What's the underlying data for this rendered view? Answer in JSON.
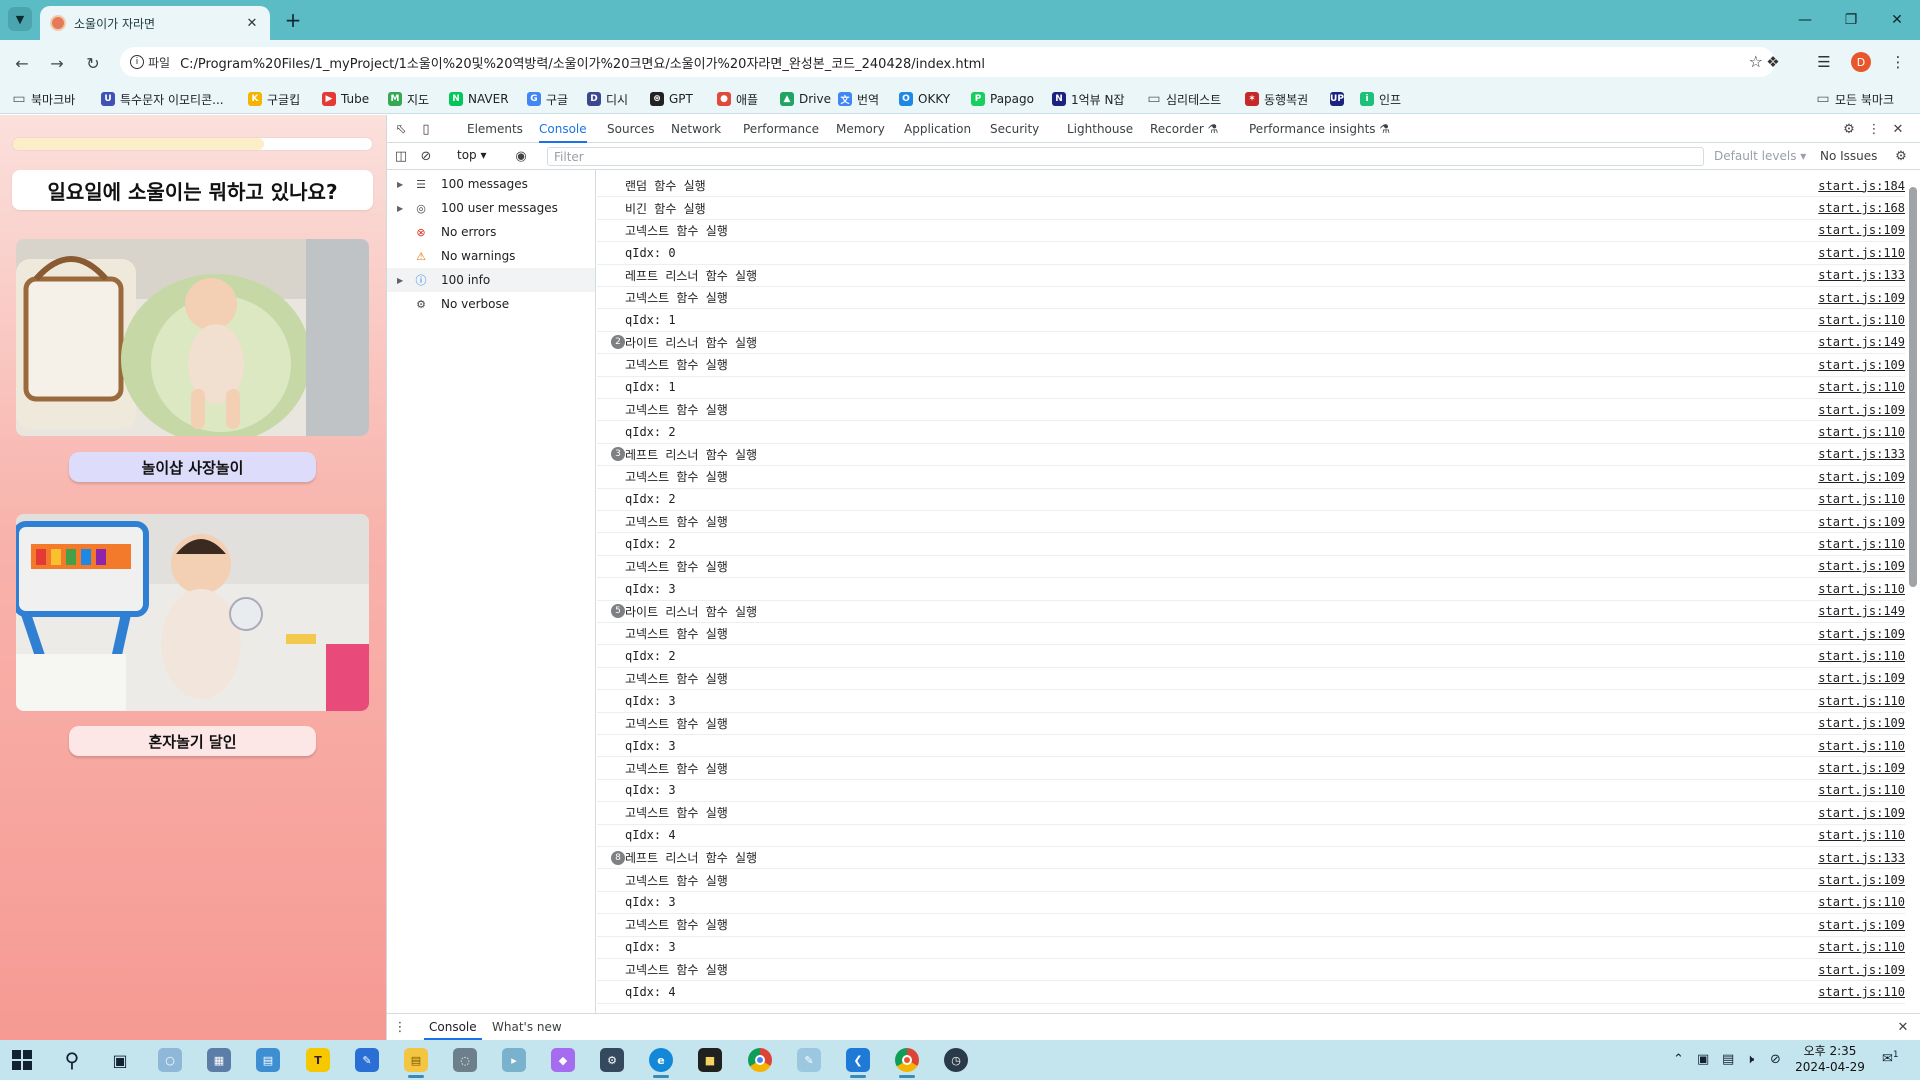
{
  "browser": {
    "tab_title": "소울이가 자라면",
    "url_chip": "파일",
    "url": "C:/Program%20Files/1_myProject/1소울이%20및%20역방력/소울이가%20크면요/소울이가%20자라면_완성본_코드_240428/index.html",
    "profile_initial": "D"
  },
  "bookmarks": [
    {
      "label": "북마크바",
      "icon": "folder-icon",
      "color": "#4d5b5e"
    },
    {
      "label": "특수문자 이모티콘...",
      "icon": "un-icon",
      "color": "#3f51b5"
    },
    {
      "label": "구글킵",
      "icon": "keep-icon",
      "color": "#f4b400"
    },
    {
      "label": "Tube",
      "icon": "youtube-icon",
      "color": "#e53935"
    },
    {
      "label": "지도",
      "icon": "map-icon",
      "color": "#34a853"
    },
    {
      "label": "NAVER",
      "icon": "naver-icon",
      "color": "#03c75a"
    },
    {
      "label": "구글",
      "icon": "google-icon",
      "color": "#4285f4"
    },
    {
      "label": "디시",
      "icon": "dc-icon",
      "color": "#3b4890"
    },
    {
      "label": "GPT",
      "icon": "gpt-icon",
      "color": "#222222"
    },
    {
      "label": "애플",
      "icon": "apple-icon",
      "color": "#e04a3a"
    },
    {
      "label": "Drive",
      "icon": "drive-icon",
      "color": "#1fa463"
    },
    {
      "label": "번역",
      "icon": "translate-icon",
      "color": "#4285f4"
    },
    {
      "label": "OKKY",
      "icon": "okky-icon",
      "color": "#1e88e5"
    },
    {
      "label": "Papago",
      "icon": "papago-icon",
      "color": "#19ce60"
    },
    {
      "label": "1억뷰 N잡",
      "icon": "n-icon",
      "color": "#1a237e"
    },
    {
      "label": "심리테스트",
      "icon": "folder-icon",
      "color": "#4d5b5e"
    },
    {
      "label": "동행복권",
      "icon": "lotto-icon",
      "color": "#c62828"
    },
    {
      "label": "",
      "icon": "up-icon",
      "color": "#1a237e"
    },
    {
      "label": "인프",
      "icon": "inflearn-icon",
      "color": "#1dc078"
    },
    {
      "label": "모든 북마크",
      "icon": "folder-icon",
      "color": "#4d5b5e"
    }
  ],
  "page": {
    "progress": 0.7,
    "question": "일요일에 소울이는 뭐하고 있나요?",
    "answers": [
      {
        "label": "놀이샵 사장놀이",
        "bg": "#dedcfb"
      },
      {
        "label": "혼자놀기 달인",
        "bg": "#fde6e6"
      }
    ]
  },
  "devtools": {
    "tabs": [
      "Elements",
      "Console",
      "Sources",
      "Network",
      "Performance",
      "Memory",
      "Application",
      "Security",
      "Lighthouse",
      "Recorder ⚗",
      "Performance insights ⚗"
    ],
    "active_tab": "Console",
    "context": "top",
    "filter_placeholder": "Filter",
    "levels": "Default levels ▾",
    "issues": "No Issues",
    "sidebar": [
      {
        "label": "100 messages",
        "icon": "list-icon",
        "expandable": true
      },
      {
        "label": "100 user messages",
        "icon": "user-icon",
        "expandable": true
      },
      {
        "label": "No errors",
        "icon": "error-icon",
        "expandable": false
      },
      {
        "label": "No warnings",
        "icon": "warning-icon",
        "expandable": false
      },
      {
        "label": "100 info",
        "icon": "info-icon",
        "expandable": true
      },
      {
        "label": "No verbose",
        "icon": "verbose-icon",
        "expandable": false
      }
    ],
    "log": [
      {
        "msg": "랜덤 함수 실행",
        "src": "start.js:184",
        "badge": ""
      },
      {
        "msg": "비긴 함수 실행",
        "src": "start.js:168",
        "badge": ""
      },
      {
        "msg": "고넥스트 함수 실행",
        "src": "start.js:109",
        "badge": ""
      },
      {
        "msg": "qIdx: 0",
        "src": "start.js:110",
        "badge": ""
      },
      {
        "msg": "레프트 리스너 함수 실행",
        "src": "start.js:133",
        "badge": ""
      },
      {
        "msg": "고넥스트 함수 실행",
        "src": "start.js:109",
        "badge": ""
      },
      {
        "msg": "qIdx: 1",
        "src": "start.js:110",
        "badge": ""
      },
      {
        "msg": "라이트 리스너 함수 실행",
        "src": "start.js:149",
        "badge": "2"
      },
      {
        "msg": "고넥스트 함수 실행",
        "src": "start.js:109",
        "badge": ""
      },
      {
        "msg": "qIdx: 1",
        "src": "start.js:110",
        "badge": ""
      },
      {
        "msg": "고넥스트 함수 실행",
        "src": "start.js:109",
        "badge": ""
      },
      {
        "msg": "qIdx: 2",
        "src": "start.js:110",
        "badge": ""
      },
      {
        "msg": "레프트 리스너 함수 실행",
        "src": "start.js:133",
        "badge": "3"
      },
      {
        "msg": "고넥스트 함수 실행",
        "src": "start.js:109",
        "badge": ""
      },
      {
        "msg": "qIdx: 2",
        "src": "start.js:110",
        "badge": ""
      },
      {
        "msg": "고넥스트 함수 실행",
        "src": "start.js:109",
        "badge": ""
      },
      {
        "msg": "qIdx: 2",
        "src": "start.js:110",
        "badge": ""
      },
      {
        "msg": "고넥스트 함수 실행",
        "src": "start.js:109",
        "badge": ""
      },
      {
        "msg": "qIdx: 3",
        "src": "start.js:110",
        "badge": ""
      },
      {
        "msg": "라이트 리스너 함수 실행",
        "src": "start.js:149",
        "badge": "5"
      },
      {
        "msg": "고넥스트 함수 실행",
        "src": "start.js:109",
        "badge": ""
      },
      {
        "msg": "qIdx: 2",
        "src": "start.js:110",
        "badge": ""
      },
      {
        "msg": "고넥스트 함수 실행",
        "src": "start.js:109",
        "badge": ""
      },
      {
        "msg": "qIdx: 3",
        "src": "start.js:110",
        "badge": ""
      },
      {
        "msg": "고넥스트 함수 실행",
        "src": "start.js:109",
        "badge": ""
      },
      {
        "msg": "qIdx: 3",
        "src": "start.js:110",
        "badge": ""
      },
      {
        "msg": "고넥스트 함수 실행",
        "src": "start.js:109",
        "badge": ""
      },
      {
        "msg": "qIdx: 3",
        "src": "start.js:110",
        "badge": ""
      },
      {
        "msg": "고넥스트 함수 실행",
        "src": "start.js:109",
        "badge": ""
      },
      {
        "msg": "qIdx: 4",
        "src": "start.js:110",
        "badge": ""
      },
      {
        "msg": "레프트 리스너 함수 실행",
        "src": "start.js:133",
        "badge": "8"
      },
      {
        "msg": "고넥스트 함수 실행",
        "src": "start.js:109",
        "badge": ""
      },
      {
        "msg": "qIdx: 3",
        "src": "start.js:110",
        "badge": ""
      },
      {
        "msg": "고넥스트 함수 실행",
        "src": "start.js:109",
        "badge": ""
      },
      {
        "msg": "qIdx: 3",
        "src": "start.js:110",
        "badge": ""
      },
      {
        "msg": "고넥스트 함수 실행",
        "src": "start.js:109",
        "badge": ""
      },
      {
        "msg": "qIdx: 4",
        "src": "start.js:110",
        "badge": ""
      }
    ],
    "drawer_tabs": [
      "Console",
      "What's new"
    ]
  },
  "taskbar": {
    "time": "오후 2:35",
    "date": "2024-04-29",
    "notification_count": "1"
  }
}
